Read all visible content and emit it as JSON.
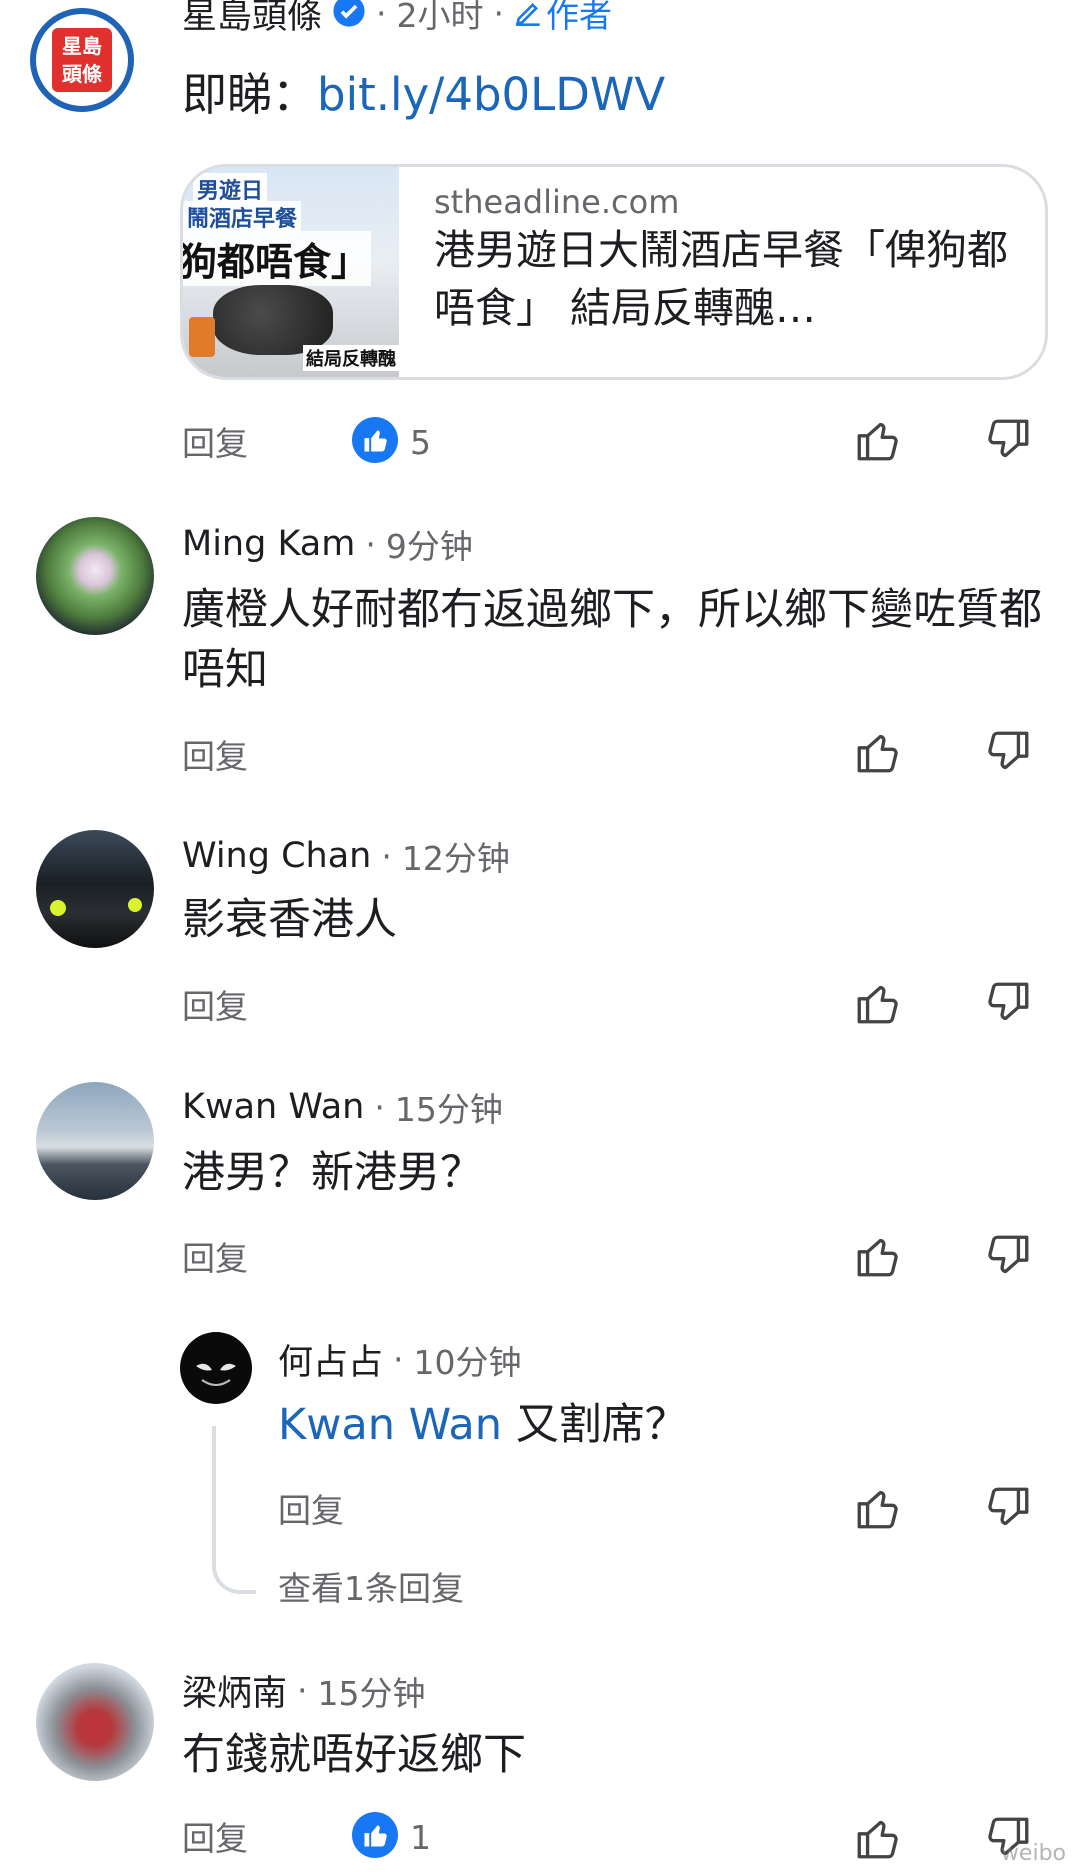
{
  "post": {
    "author": "星島頭條",
    "time": "2小时",
    "author_badge": "作者",
    "text_prefix": "即睇：",
    "link": "bit.ly/4b0LDWV",
    "logo_line1": "星島",
    "logo_line2": "頭條",
    "card": {
      "domain": "stheadline.com",
      "title": "港男遊日大鬧酒店早餐「俾狗都唔食」 結局反轉醜…",
      "thumb_line1": "男遊日",
      "thumb_line2": "鬧酒店早餐",
      "thumb_line3": "狗都唔食」",
      "thumb_footer": "結局反轉醜"
    },
    "reply_label": "回复",
    "like_count": "5"
  },
  "comments": [
    {
      "name": "Ming Kam",
      "time": "9分钟",
      "text": "廣橙人好耐都冇返過鄉下，所以鄉下變咗質都唔知",
      "reply_label": "回复"
    },
    {
      "name": "Wing Chan",
      "time": "12分钟",
      "text": "影衰香港人",
      "reply_label": "回复"
    },
    {
      "name": "Kwan Wan",
      "time": "15分钟",
      "text": "港男？新港男？",
      "reply_label": "回复"
    },
    {
      "name": "梁炳南",
      "time": "15分钟",
      "text": "冇錢就唔好返鄉下",
      "reply_label": "回复",
      "like_count": "1"
    }
  ],
  "nested_reply": {
    "name": "何占占",
    "time": "10分钟",
    "mention": "Kwan Wan",
    "text": "又割席？",
    "reply_label": "回复",
    "view_more": "查看1条回复"
  },
  "colors": {
    "accent": "#1b66b8",
    "like_blue": "#1877f2",
    "meta_gray": "#65676b"
  },
  "watermark": "weibo"
}
